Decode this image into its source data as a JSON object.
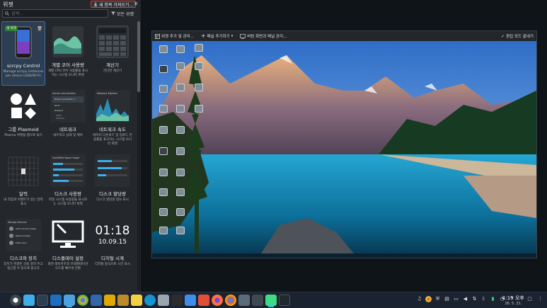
{
  "panel": {
    "title": "위젯",
    "get_new_label": "새 항목 가져오기...",
    "close_icon": "✕",
    "search_placeholder": "검색...",
    "filter_label": "모든 위젯"
  },
  "widgets": [
    {
      "name": "scrcpy Control",
      "desc": "Manage scrcpy instances per device (USB/Wi-Fi)",
      "icon": "phone-icon",
      "badge": "새 위젯"
    },
    {
      "name": "개별 코어 사용량",
      "desc": "개별 CPU 코어 사용률을 표시하는 시스템 모니터 위젯",
      "icon": "cpu-graph-icon"
    },
    {
      "name": "계산기",
      "desc": "간단한 계산기",
      "icon": "calculator-icon"
    },
    {
      "name": "그룹 Plasmoid",
      "desc": "Plasma 위젯을 탭으로 묶기",
      "icon": "shapes-icon"
    },
    {
      "name": "네트워크",
      "desc": "네트워크 상태 및 제어",
      "icon": "network-icon"
    },
    {
      "name": "네트워크 속도",
      "desc": "데이터 다운로드 및 업로드 전송률을 표시하는 시스템 모니터 위젯",
      "icon": "network-speed-icon"
    },
    {
      "name": "달력",
      "desc": "내 작업과 이벤트가 있는 달력 표시",
      "icon": "calendar-icon"
    },
    {
      "name": "디스크 사용량",
      "desc": "파일 시스템 사용량을 표시하는 시스템 모니터 위젯",
      "icon": "disk-usage-icon"
    },
    {
      "name": "디스크 할당량",
      "desc": "디스크 할당량 정보 표시",
      "icon": "disk-quota-icon"
    },
    {
      "name": "디스크와 장치",
      "desc": "장치가 연결된 것을 알려 주고 접근할 수 있도록 합니다",
      "icon": "devices-icon"
    },
    {
      "name": "디스플레이 설정",
      "desc": "화면 레이아웃과 프레젠테이션 모드를 빠르게 전환",
      "icon": "monitor-icon"
    },
    {
      "name": "디지털 시계",
      "desc": "디지털 형식으로 시간 표시",
      "icon": "digital-clock-icon",
      "clock_time": "01:18",
      "clock_date": "10.09.15"
    }
  ],
  "thumbs": {
    "network": [
      "Active connections",
      "Wired connection 1",
      "Wi-Fi",
      "Hotspot"
    ],
    "netspeed_title": "Network Monitor",
    "disk_usage_title": "Used/Total Space Usage",
    "devices_title": "Storage Volumes",
    "devices_items": [
      "ext4 volume media",
      "Optical media",
      "Flash card"
    ]
  },
  "toolbar": {
    "add_widgets": "위젯 추가 및 관리...",
    "add_panel": "패널 추가하기",
    "configure_displays": "바탕 화면과 패널 관리...",
    "exit_edit": "편집 모드 끝내기"
  },
  "taskbar": {
    "time": "1:19 오후",
    "date": "26. 5. 21."
  },
  "colors": {
    "panel_bg": "#24272b",
    "accent": "#3daee9",
    "get_new_border": "#e53935",
    "badge_green": "#2e7d32"
  }
}
